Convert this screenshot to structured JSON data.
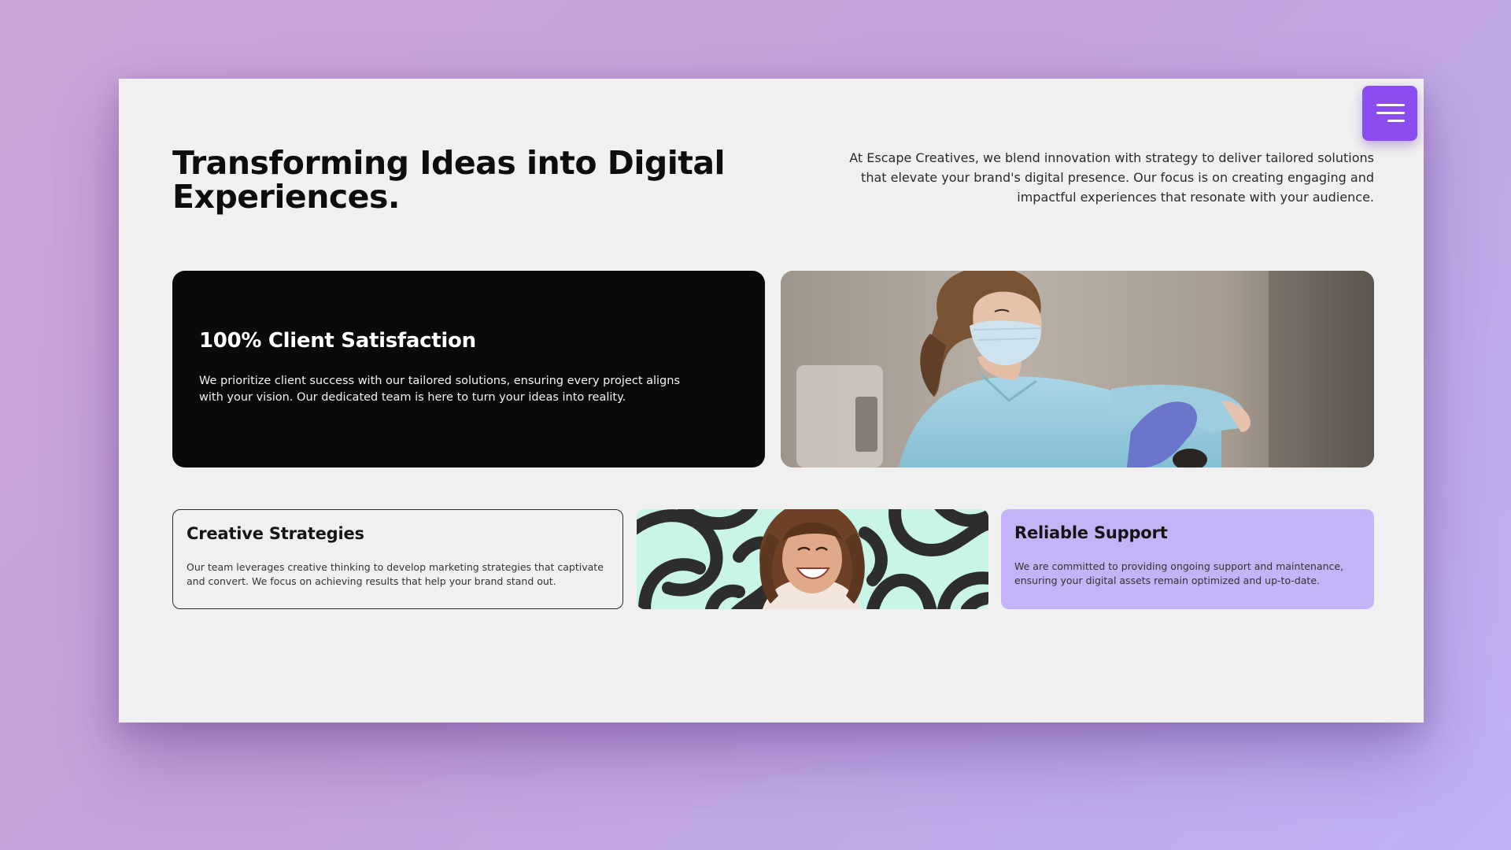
{
  "menu": {
    "icon": "hamburger-menu-icon",
    "color": "#8b4cf0"
  },
  "hero": {
    "title": "Transforming Ideas into Digital Experiences.",
    "description": "At Escape Creatives, we blend innovation with strategy to deliver tailored solutions that elevate your brand's digital presence. Our focus is on creating engaging and impactful experiences that resonate with your audience."
  },
  "satisfaction_card": {
    "title": "100% Client Satisfaction",
    "text": "We prioritize client success with our tailored solutions, ensuring every project aligns with your vision. Our dedicated team is here to turn your ideas into reality."
  },
  "creative_card": {
    "title": "Creative Strategies",
    "text": "Our team leverages creative thinking to develop marketing strategies that captivate and convert. We focus on achieving results that help your brand stand out."
  },
  "support_card": {
    "title": "Reliable Support",
    "text": "We are committed to providing ongoing support and maintenance, ensuring your digital assets remain optimized and up-to-date.",
    "color": "#c4b3f6"
  },
  "colors": {
    "accent": "#8b4cf0",
    "dark_card": "#0a0a0a",
    "pattern_mint": "#c9f5e8",
    "pattern_dark": "#2d2d2d"
  }
}
